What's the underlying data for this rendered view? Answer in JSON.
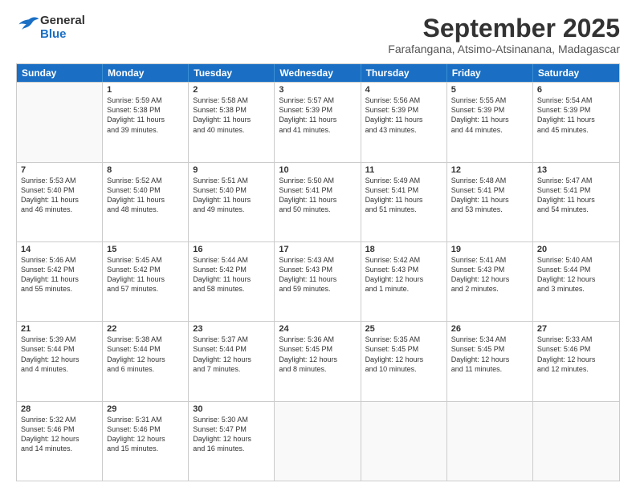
{
  "header": {
    "logo_line1": "General",
    "logo_line2": "Blue",
    "month": "September 2025",
    "location": "Farafangana, Atsimo-Atsinanana, Madagascar"
  },
  "days_of_week": [
    "Sunday",
    "Monday",
    "Tuesday",
    "Wednesday",
    "Thursday",
    "Friday",
    "Saturday"
  ],
  "rows": [
    [
      {
        "day": "",
        "lines": []
      },
      {
        "day": "1",
        "lines": [
          "Sunrise: 5:59 AM",
          "Sunset: 5:38 PM",
          "Daylight: 11 hours",
          "and 39 minutes."
        ]
      },
      {
        "day": "2",
        "lines": [
          "Sunrise: 5:58 AM",
          "Sunset: 5:38 PM",
          "Daylight: 11 hours",
          "and 40 minutes."
        ]
      },
      {
        "day": "3",
        "lines": [
          "Sunrise: 5:57 AM",
          "Sunset: 5:39 PM",
          "Daylight: 11 hours",
          "and 41 minutes."
        ]
      },
      {
        "day": "4",
        "lines": [
          "Sunrise: 5:56 AM",
          "Sunset: 5:39 PM",
          "Daylight: 11 hours",
          "and 43 minutes."
        ]
      },
      {
        "day": "5",
        "lines": [
          "Sunrise: 5:55 AM",
          "Sunset: 5:39 PM",
          "Daylight: 11 hours",
          "and 44 minutes."
        ]
      },
      {
        "day": "6",
        "lines": [
          "Sunrise: 5:54 AM",
          "Sunset: 5:39 PM",
          "Daylight: 11 hours",
          "and 45 minutes."
        ]
      }
    ],
    [
      {
        "day": "7",
        "lines": [
          "Sunrise: 5:53 AM",
          "Sunset: 5:40 PM",
          "Daylight: 11 hours",
          "and 46 minutes."
        ]
      },
      {
        "day": "8",
        "lines": [
          "Sunrise: 5:52 AM",
          "Sunset: 5:40 PM",
          "Daylight: 11 hours",
          "and 48 minutes."
        ]
      },
      {
        "day": "9",
        "lines": [
          "Sunrise: 5:51 AM",
          "Sunset: 5:40 PM",
          "Daylight: 11 hours",
          "and 49 minutes."
        ]
      },
      {
        "day": "10",
        "lines": [
          "Sunrise: 5:50 AM",
          "Sunset: 5:41 PM",
          "Daylight: 11 hours",
          "and 50 minutes."
        ]
      },
      {
        "day": "11",
        "lines": [
          "Sunrise: 5:49 AM",
          "Sunset: 5:41 PM",
          "Daylight: 11 hours",
          "and 51 minutes."
        ]
      },
      {
        "day": "12",
        "lines": [
          "Sunrise: 5:48 AM",
          "Sunset: 5:41 PM",
          "Daylight: 11 hours",
          "and 53 minutes."
        ]
      },
      {
        "day": "13",
        "lines": [
          "Sunrise: 5:47 AM",
          "Sunset: 5:41 PM",
          "Daylight: 11 hours",
          "and 54 minutes."
        ]
      }
    ],
    [
      {
        "day": "14",
        "lines": [
          "Sunrise: 5:46 AM",
          "Sunset: 5:42 PM",
          "Daylight: 11 hours",
          "and 55 minutes."
        ]
      },
      {
        "day": "15",
        "lines": [
          "Sunrise: 5:45 AM",
          "Sunset: 5:42 PM",
          "Daylight: 11 hours",
          "and 57 minutes."
        ]
      },
      {
        "day": "16",
        "lines": [
          "Sunrise: 5:44 AM",
          "Sunset: 5:42 PM",
          "Daylight: 11 hours",
          "and 58 minutes."
        ]
      },
      {
        "day": "17",
        "lines": [
          "Sunrise: 5:43 AM",
          "Sunset: 5:43 PM",
          "Daylight: 11 hours",
          "and 59 minutes."
        ]
      },
      {
        "day": "18",
        "lines": [
          "Sunrise: 5:42 AM",
          "Sunset: 5:43 PM",
          "Daylight: 12 hours",
          "and 1 minute."
        ]
      },
      {
        "day": "19",
        "lines": [
          "Sunrise: 5:41 AM",
          "Sunset: 5:43 PM",
          "Daylight: 12 hours",
          "and 2 minutes."
        ]
      },
      {
        "day": "20",
        "lines": [
          "Sunrise: 5:40 AM",
          "Sunset: 5:44 PM",
          "Daylight: 12 hours",
          "and 3 minutes."
        ]
      }
    ],
    [
      {
        "day": "21",
        "lines": [
          "Sunrise: 5:39 AM",
          "Sunset: 5:44 PM",
          "Daylight: 12 hours",
          "and 4 minutes."
        ]
      },
      {
        "day": "22",
        "lines": [
          "Sunrise: 5:38 AM",
          "Sunset: 5:44 PM",
          "Daylight: 12 hours",
          "and 6 minutes."
        ]
      },
      {
        "day": "23",
        "lines": [
          "Sunrise: 5:37 AM",
          "Sunset: 5:44 PM",
          "Daylight: 12 hours",
          "and 7 minutes."
        ]
      },
      {
        "day": "24",
        "lines": [
          "Sunrise: 5:36 AM",
          "Sunset: 5:45 PM",
          "Daylight: 12 hours",
          "and 8 minutes."
        ]
      },
      {
        "day": "25",
        "lines": [
          "Sunrise: 5:35 AM",
          "Sunset: 5:45 PM",
          "Daylight: 12 hours",
          "and 10 minutes."
        ]
      },
      {
        "day": "26",
        "lines": [
          "Sunrise: 5:34 AM",
          "Sunset: 5:45 PM",
          "Daylight: 12 hours",
          "and 11 minutes."
        ]
      },
      {
        "day": "27",
        "lines": [
          "Sunrise: 5:33 AM",
          "Sunset: 5:46 PM",
          "Daylight: 12 hours",
          "and 12 minutes."
        ]
      }
    ],
    [
      {
        "day": "28",
        "lines": [
          "Sunrise: 5:32 AM",
          "Sunset: 5:46 PM",
          "Daylight: 12 hours",
          "and 14 minutes."
        ]
      },
      {
        "day": "29",
        "lines": [
          "Sunrise: 5:31 AM",
          "Sunset: 5:46 PM",
          "Daylight: 12 hours",
          "and 15 minutes."
        ]
      },
      {
        "day": "30",
        "lines": [
          "Sunrise: 5:30 AM",
          "Sunset: 5:47 PM",
          "Daylight: 12 hours",
          "and 16 minutes."
        ]
      },
      {
        "day": "",
        "lines": []
      },
      {
        "day": "",
        "lines": []
      },
      {
        "day": "",
        "lines": []
      },
      {
        "day": "",
        "lines": []
      }
    ]
  ]
}
